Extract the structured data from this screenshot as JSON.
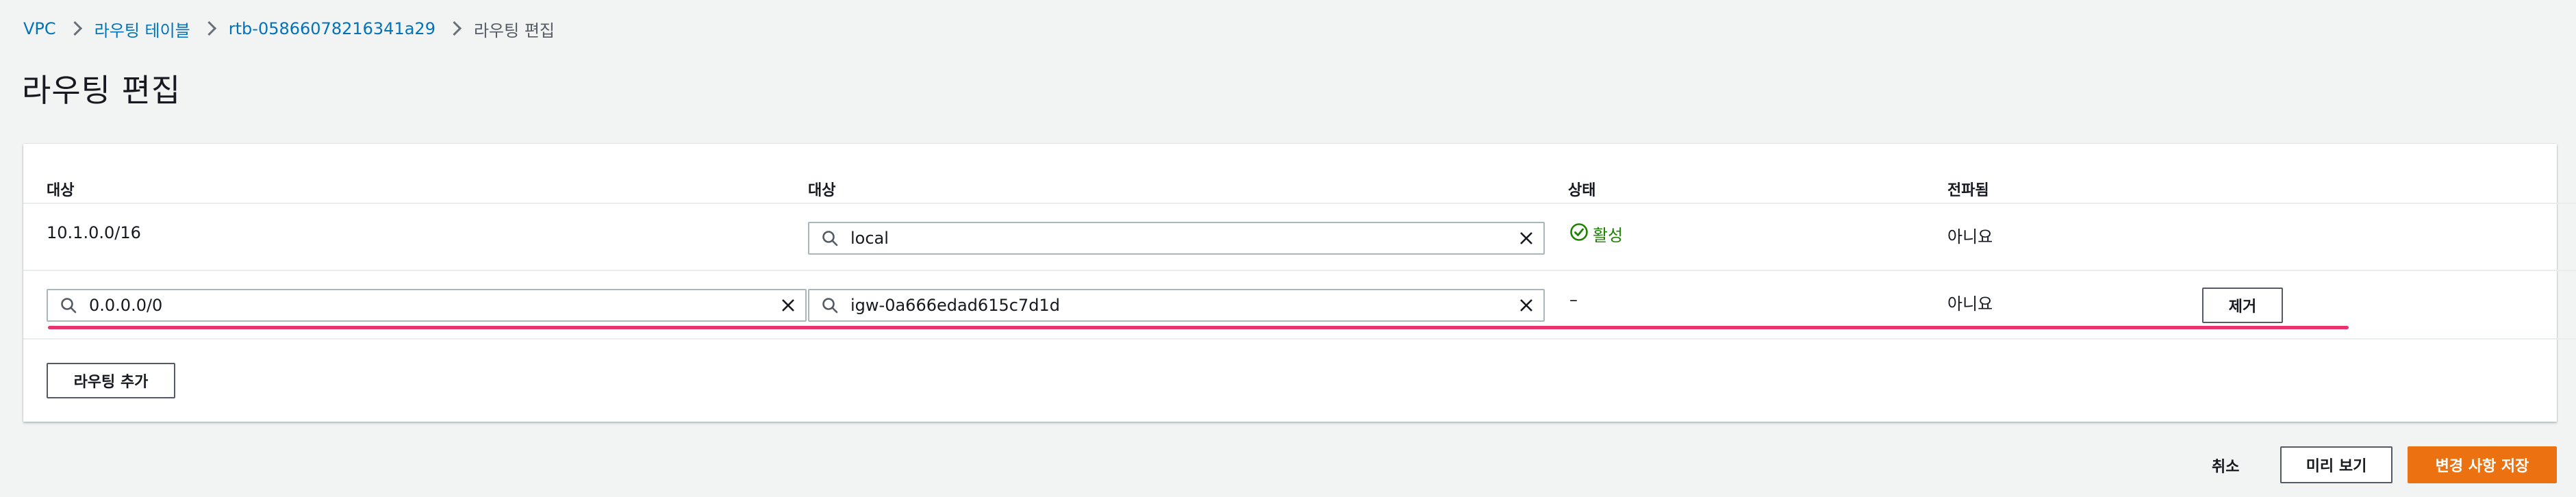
{
  "breadcrumb": {
    "items": [
      "VPC",
      "라우팅 테이블",
      "rtb-05866078216341a29"
    ],
    "current": "라우팅 편집"
  },
  "page": {
    "title": "라우팅 편집"
  },
  "table": {
    "headers": [
      "대상",
      "대상",
      "상태",
      "전파됨"
    ],
    "rows": [
      {
        "destination": "10.1.0.0/16",
        "target": "local",
        "status": "활성",
        "propagated": "아니요"
      },
      {
        "destination": "0.0.0.0/0",
        "target": "igw-0a666edad615c7d1d",
        "status": "–",
        "propagated": "아니요",
        "remove_label": "제거"
      }
    ],
    "add_route_label": "라우팅 추가"
  },
  "footer": {
    "cancel_label": "취소",
    "preview_label": "미리 보기",
    "save_label": "변경 사항 저장"
  },
  "colors": {
    "link": "#0073bb",
    "success": "#1d8102",
    "primary": "#ec7211",
    "annotation": "#e8336c"
  },
  "icons": [
    "chevron-right-icon",
    "search-icon",
    "clear-icon",
    "status-success-icon"
  ]
}
